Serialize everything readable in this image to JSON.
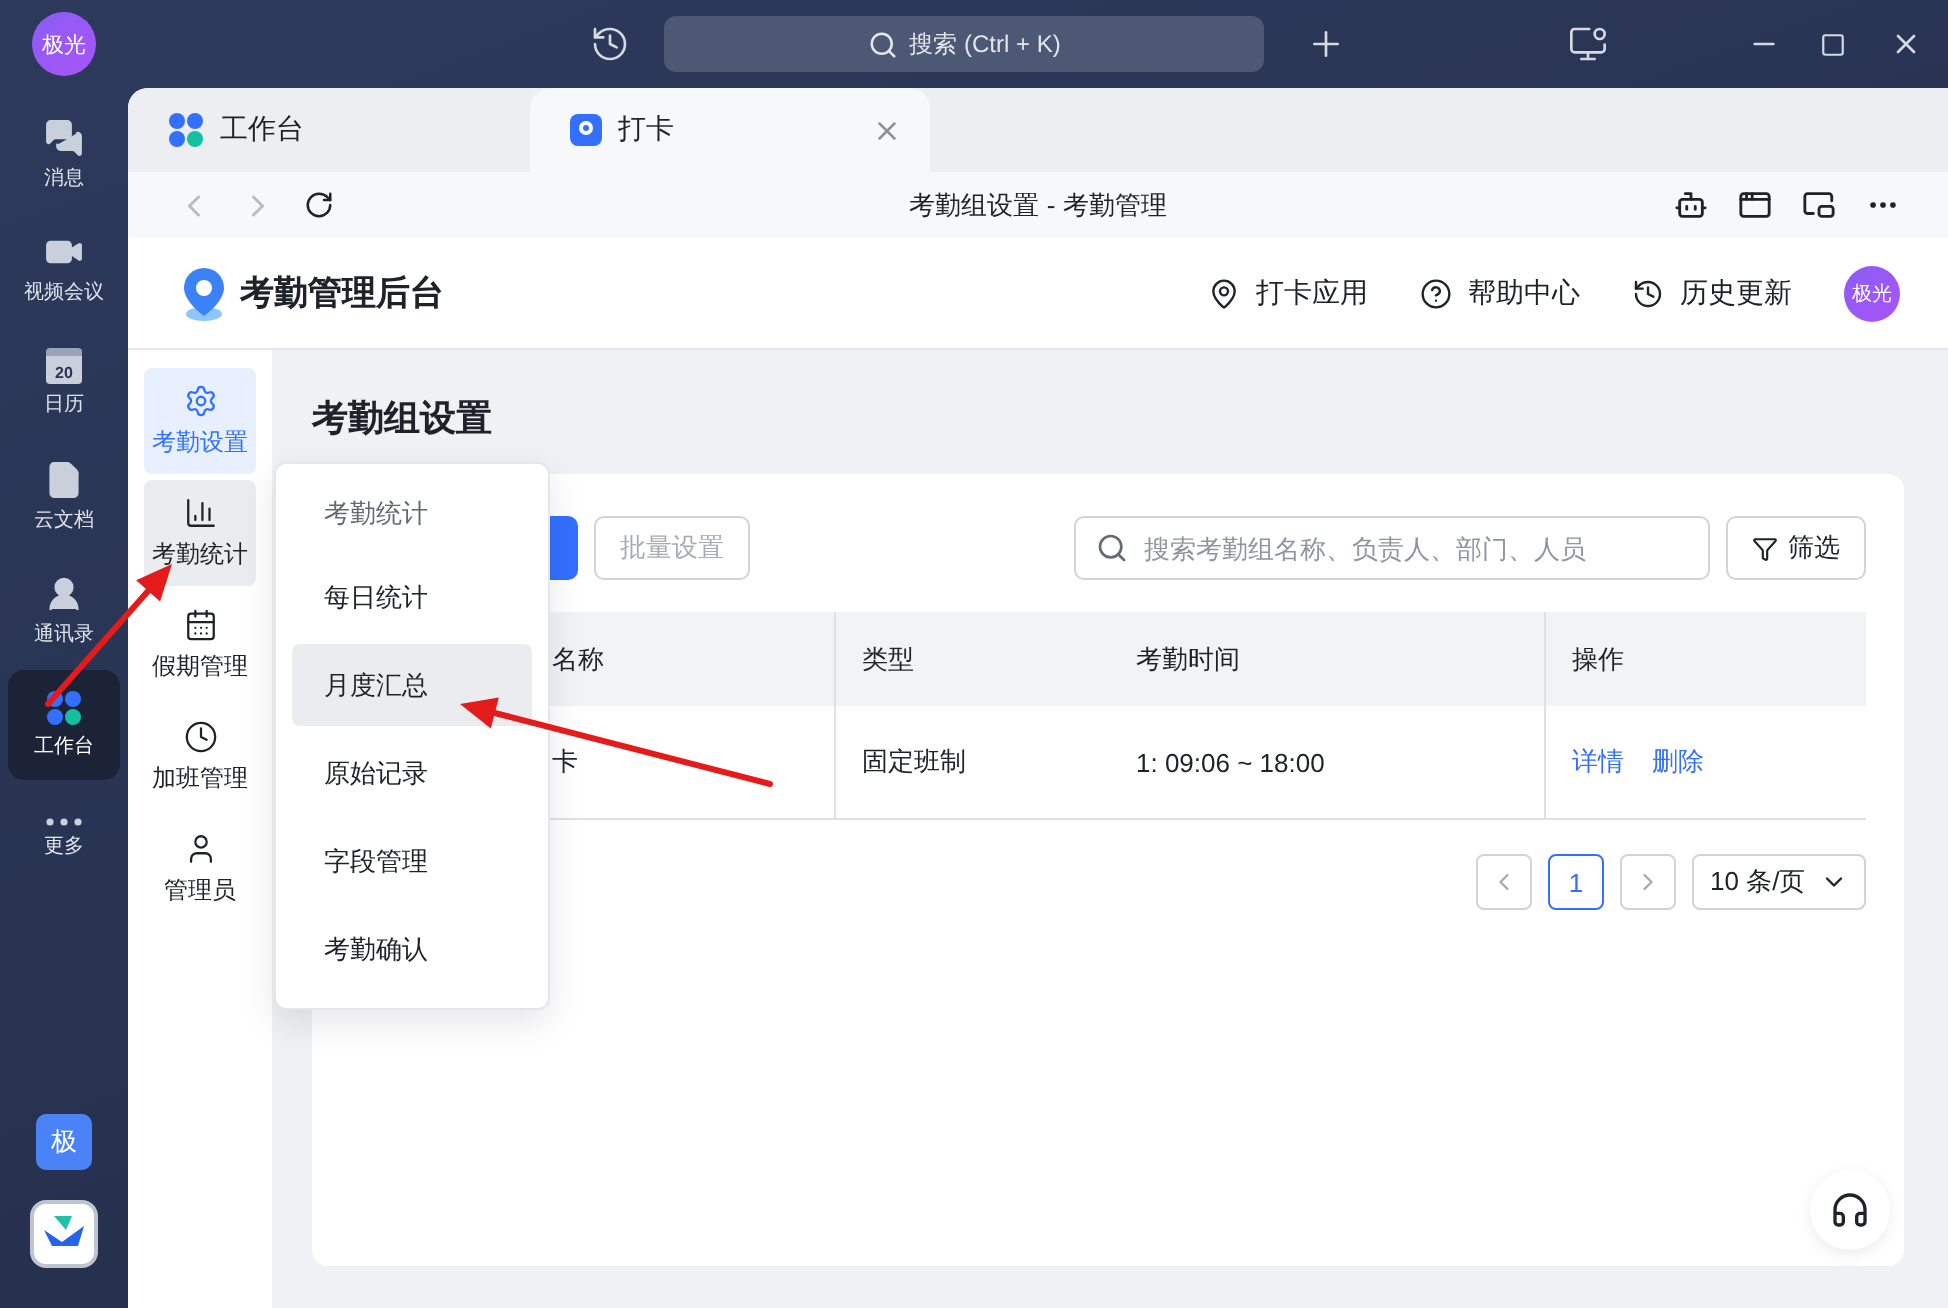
{
  "rail": {
    "avatar": "极光",
    "items": [
      {
        "kind": "messages",
        "label": "消息",
        "selected": false
      },
      {
        "kind": "video",
        "label": "视频会议",
        "selected": false
      },
      {
        "kind": "calendar",
        "label": "日历",
        "selected": false,
        "day": "20"
      },
      {
        "kind": "docs",
        "label": "云文档",
        "selected": false
      },
      {
        "kind": "contacts",
        "label": "通讯录",
        "selected": false
      },
      {
        "kind": "workbench",
        "label": "工作台",
        "selected": true
      },
      {
        "kind": "more",
        "label": "更多",
        "selected": false
      }
    ],
    "badge": "极"
  },
  "top_bar": {
    "search": "搜索 (Ctrl + K)"
  },
  "tabs": [
    {
      "kind": "workbench",
      "label": "工作台",
      "selected": false
    },
    {
      "kind": "app",
      "label": "打卡",
      "selected": true
    }
  ],
  "page_title": "考勤组设置 - 考勤管理",
  "app_header": {
    "title": "考勤管理后台",
    "links": [
      {
        "kind": "pin",
        "label": "打卡应用"
      },
      {
        "kind": "help",
        "label": "帮助中心"
      },
      {
        "kind": "history",
        "label": "历史更新"
      }
    ],
    "avatar": "极光"
  },
  "sub_nav": [
    {
      "kind": "gear",
      "label": "考勤设置",
      "selected": true,
      "hovered": false
    },
    {
      "kind": "chart",
      "label": "考勤统计",
      "selected": false,
      "hovered": true
    },
    {
      "kind": "calendar",
      "label": "假期管理",
      "selected": false,
      "hovered": false
    },
    {
      "kind": "clock",
      "label": "加班管理",
      "selected": false,
      "hovered": false
    },
    {
      "kind": "user",
      "label": "管理员",
      "selected": false,
      "hovered": false
    }
  ],
  "section_title": "考勤组设置",
  "toolbar": {
    "batch_button": "批量设置",
    "search_placeholder": "搜索考勤组名称、负责人、部门、人员",
    "filter_button": "筛选"
  },
  "table": {
    "columns": [
      "名称",
      "类型",
      "考勤时间",
      "操作"
    ],
    "rows": [
      {
        "cells": [
          "卡",
          "固定班制",
          "1: 09:06 ~ 18:00"
        ],
        "actions": [
          "详情",
          "删除"
        ]
      }
    ]
  },
  "pagination": {
    "pages": [
      {
        "label": "1",
        "selected": true
      }
    ],
    "page_size": "10 条/页"
  },
  "menu": {
    "items": [
      {
        "kind": "heading",
        "label": "考勤统计",
        "highlighted": false
      },
      {
        "kind": "item",
        "label": "每日统计",
        "highlighted": false
      },
      {
        "kind": "item",
        "label": "月度汇总",
        "highlighted": true
      },
      {
        "kind": "item",
        "label": "原始记录",
        "highlighted": false
      },
      {
        "kind": "item",
        "label": "字段管理",
        "highlighted": false
      },
      {
        "kind": "item",
        "label": "考勤确认",
        "highlighted": false
      }
    ]
  }
}
